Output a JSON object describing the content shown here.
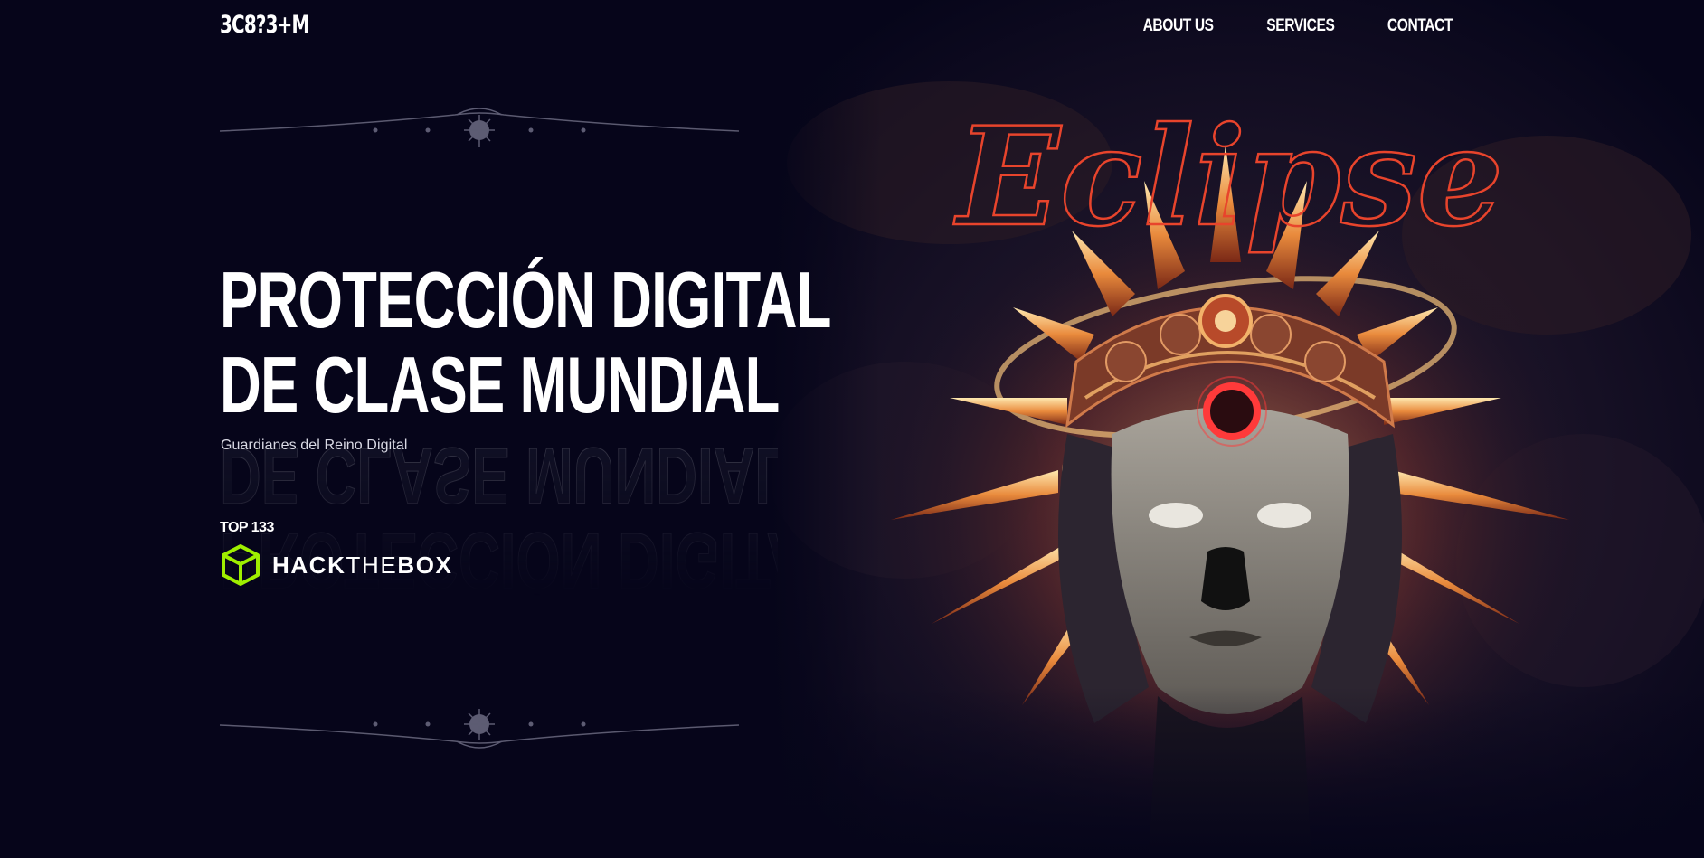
{
  "nav": {
    "logo": "3C8?3+M",
    "links": [
      {
        "label": "ABOUT US"
      },
      {
        "label": "SERVICES"
      },
      {
        "label": "CONTACT"
      }
    ]
  },
  "hero": {
    "heading_line1": "PROTECCIÓN DIGITAL",
    "heading_line2": "DE CLASE MUNDIAL",
    "subtitle": "Guardianes del Reino Digital",
    "rank_label": "TOP 133",
    "badge": {
      "name_part1": "HACK",
      "name_part2": "THE",
      "name_part3": "BOX",
      "icon": "hackthebox-cube-icon"
    },
    "art": {
      "title": "Eclipse",
      "icon": "eclipse-mask-illustration"
    }
  },
  "colors": {
    "background": "#06051a",
    "accent_green": "#9fef00",
    "eclipse_red": "#e8442c",
    "glow_orange": "#f7b24a"
  }
}
